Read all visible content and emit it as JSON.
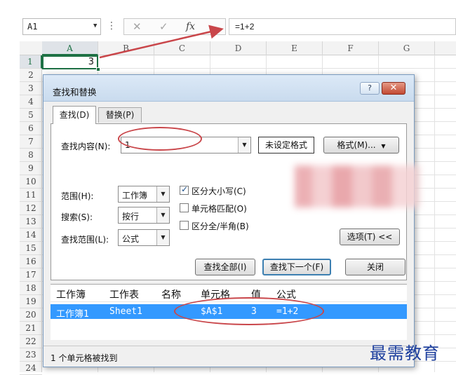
{
  "formula_bar": {
    "name_box": "A1",
    "fx_icon": "fx-icon",
    "formula": "=1+2"
  },
  "sheet": {
    "columns": [
      "A",
      "B",
      "C",
      "D",
      "E",
      "F",
      "G"
    ],
    "rows": [
      "1",
      "2",
      "3",
      "4",
      "5",
      "6",
      "7",
      "8",
      "9",
      "10",
      "11",
      "12",
      "13",
      "14",
      "15",
      "16",
      "17",
      "18",
      "19",
      "20",
      "21",
      "22",
      "23",
      "24"
    ],
    "cell_a1_value": "3"
  },
  "dialog": {
    "title": "查找和替换",
    "help_label": "?",
    "close_label": "✕",
    "tabs": {
      "find": "查找(D)",
      "replace": "替换(P)"
    },
    "find_what_label": "查找内容(N):",
    "find_what_value": "1",
    "no_format_label": "未设定格式",
    "format_button": "格式(M)...",
    "within_label": "范围(H):",
    "within_value": "工作簿",
    "search_label": "搜索(S):",
    "search_value": "按行",
    "lookin_label": "查找范围(L):",
    "lookin_value": "公式",
    "options": {
      "match_case": {
        "label": "区分大小写(C)",
        "checked": true
      },
      "match_cell": {
        "label": "单元格匹配(O)",
        "checked": false
      },
      "match_width": {
        "label": "区分全/半角(B)",
        "checked": false
      }
    },
    "options_button": "选项(T) <<",
    "find_all_button": "查找全部(I)",
    "find_next_button": "查找下一个(F)",
    "close_button": "关闭",
    "results_headers": [
      "工作簿",
      "工作表",
      "名称",
      "单元格",
      "值",
      "公式"
    ],
    "results_rows": [
      {
        "workbook": "工作簿1",
        "sheet": "Sheet1",
        "name": "",
        "cell": "$A$1",
        "value": "3",
        "formula": "=1+2"
      }
    ],
    "status": "1 个单元格被找到"
  },
  "watermark": "最需教育",
  "colors": {
    "annotation_red": "#c9464a",
    "selection_blue": "#3399ff",
    "excel_green": "#1e7145",
    "watermark_blue": "#1d3f9e"
  }
}
